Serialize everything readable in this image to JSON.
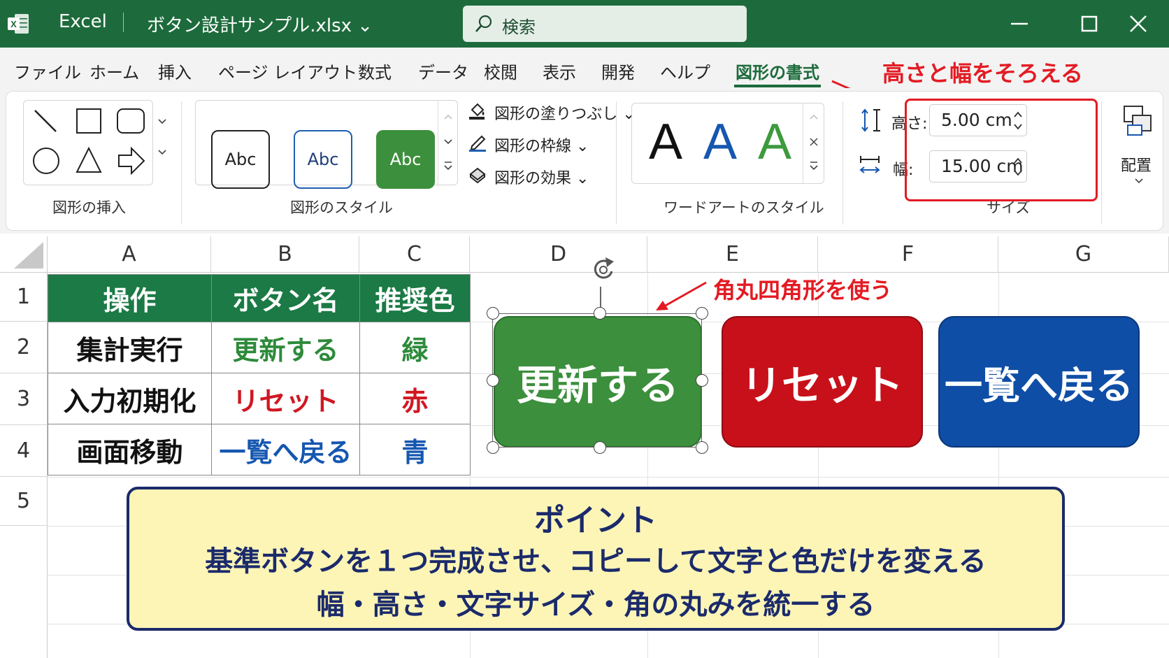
{
  "titlebar": {
    "app": "Excel",
    "filename": "ボタン設計サンプル.xlsx ⌄",
    "search_placeholder": "検索"
  },
  "menu": {
    "tabs": [
      "ファイル",
      "ホーム",
      "挿入",
      "ページ レイアウト",
      "数式",
      "データ",
      "校閲",
      "表示",
      "開発",
      "ヘルプ",
      "図形の書式"
    ],
    "active": "図形の書式"
  },
  "ribbon": {
    "insert_shapes": {
      "label": "図形の挿入"
    },
    "shape_styles": {
      "label": "図形のスタイル",
      "samples": [
        "Abc",
        "Abc",
        "Abc"
      ],
      "fill": "図形の塗りつぶし ⌄",
      "outline": "図形の枠線 ⌄",
      "effects": "図形の効果 ⌄"
    },
    "wordart": {
      "label": "ワードアートのスタイル",
      "samples": [
        "A",
        "A",
        "A"
      ]
    },
    "size": {
      "label": "サイズ",
      "height_label": "高さ:",
      "height_value": "5.00 cm",
      "width_label": "幅:",
      "width_value": "15.00 cm"
    },
    "arrange": {
      "label": "配置"
    }
  },
  "callouts": {
    "size_note": "高さと幅をそろえる",
    "shape_note": "角丸四角形を使う"
  },
  "sheet": {
    "columns": [
      "A",
      "B",
      "C",
      "D",
      "E",
      "F",
      "G"
    ],
    "rows": [
      "1",
      "2",
      "3",
      "4",
      "5"
    ],
    "headers": [
      "操作",
      "ボタン名",
      "推奨色"
    ],
    "data": [
      {
        "op": "集計実行",
        "name": "更新する",
        "color": "緑"
      },
      {
        "op": "入力初期化",
        "name": "リセット",
        "color": "赤"
      },
      {
        "op": "画面移動",
        "name": "一覧へ戻る",
        "color": "青"
      }
    ]
  },
  "buttons": [
    {
      "label": "更新する",
      "color": "#3c8f3c"
    },
    {
      "label": "リセット",
      "color": "#c8101a"
    },
    {
      "label": "一覧へ戻る",
      "color": "#0f4ea6"
    }
  ],
  "point": {
    "title": "ポイント",
    "line1": "基準ボタンを１つ完成させ、コピーして文字と色だけを変える",
    "line2": "幅・高さ・文字サイズ・角の丸みを統一する"
  },
  "colors": {
    "excel_green": "#1d6b3c",
    "accent_red": "#e31b23",
    "navy": "#1b2a6b"
  }
}
